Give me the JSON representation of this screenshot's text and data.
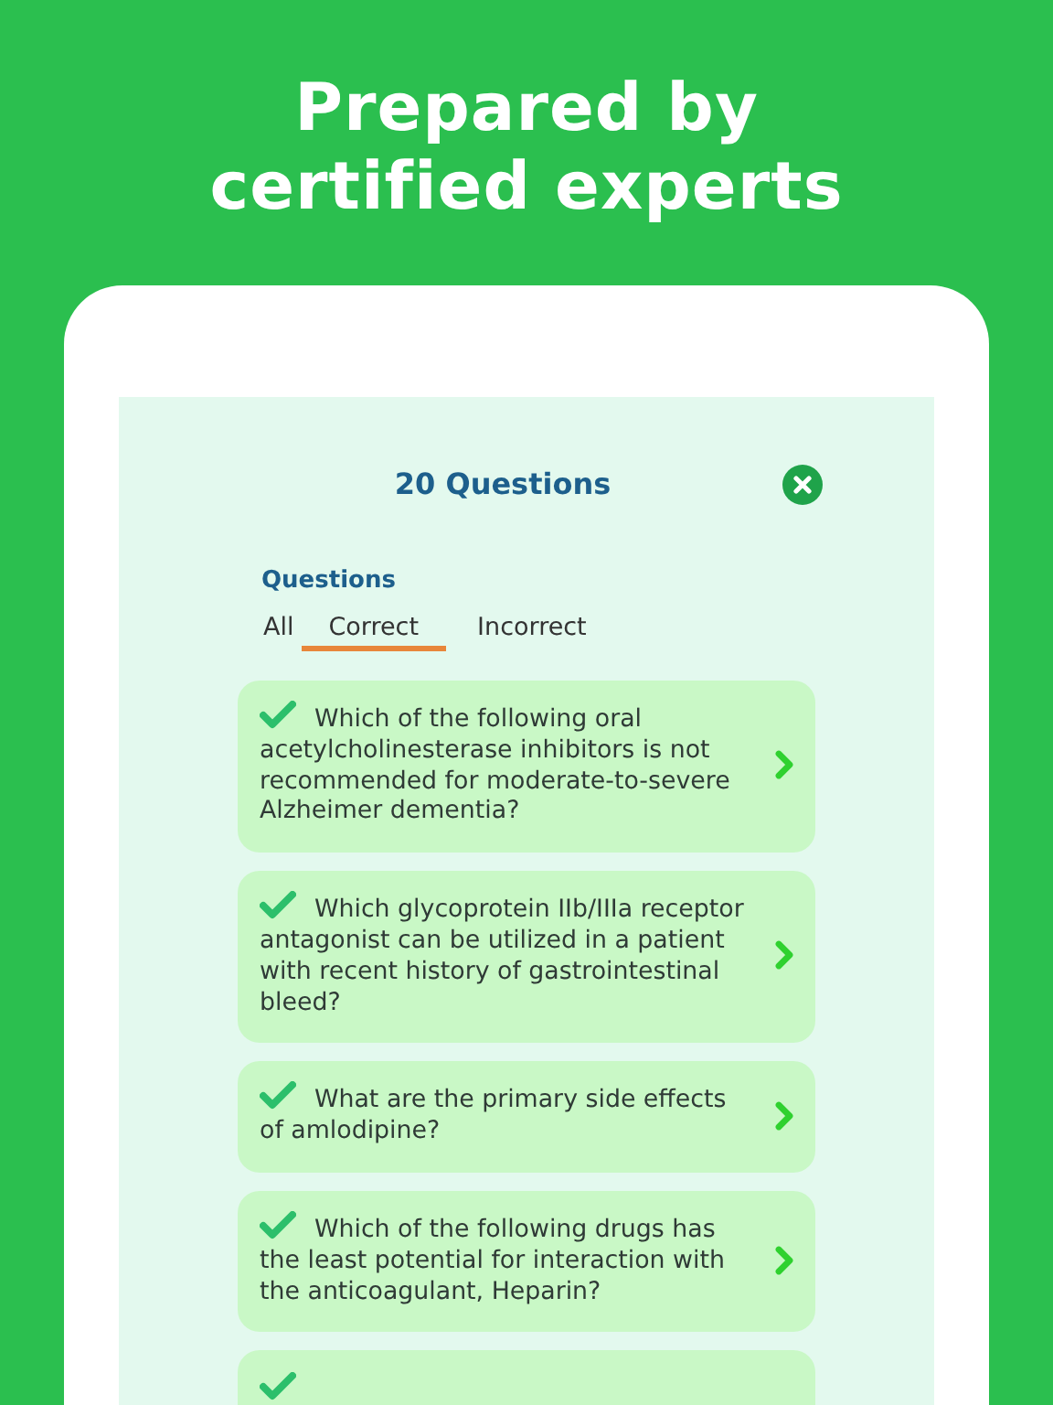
{
  "headline": {
    "lines": [
      "Prepared by",
      "certified experts"
    ]
  },
  "screen": {
    "title": "20 Questions",
    "section_label": "Questions",
    "tabs": [
      {
        "label": "All",
        "selected": false
      },
      {
        "label": "Correct",
        "selected": true
      },
      {
        "label": "Incorrect",
        "selected": false
      }
    ],
    "questions": [
      {
        "kind": "question",
        "correct": true,
        "text": "Which of the following oral acetylcholinesterase inhibitors is not recommended for moderate-to-severe Alzheimer dementia?"
      },
      {
        "kind": "question",
        "correct": true,
        "text": "Which glycoprotein IIb/IIIa receptor antagonist can be utilized in a patient with recent history of gastrointestinal bleed?"
      },
      {
        "kind": "question",
        "correct": true,
        "text": "What are the primary side effects of amlodipine?"
      },
      {
        "kind": "question",
        "correct": true,
        "text": "Which of the following drugs has the least potential for interaction with the anticoagulant, Heparin?"
      },
      {
        "kind": "partial",
        "correct": true
      }
    ]
  }
}
